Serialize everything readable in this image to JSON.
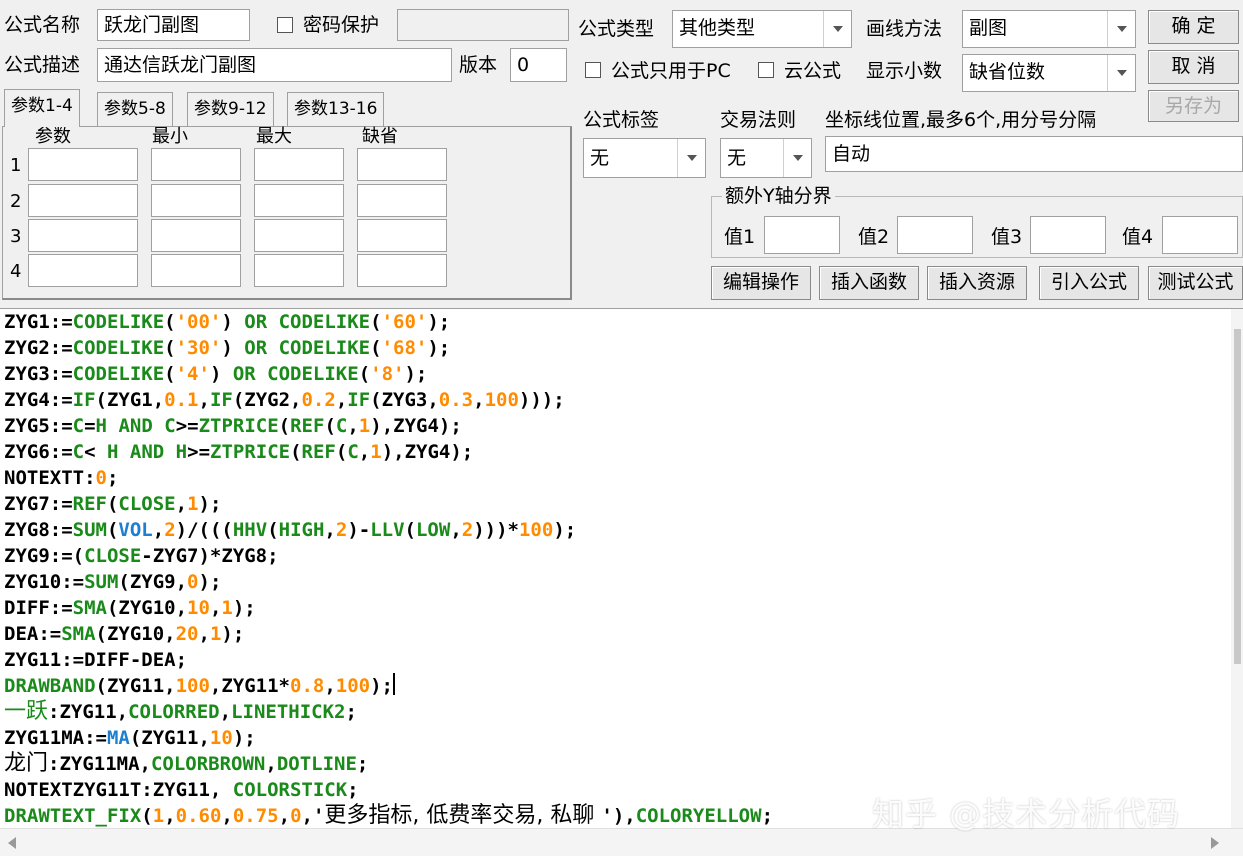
{
  "top": {
    "name_label": "公式名称",
    "name_value": "跃龙门副图",
    "password_label": "密码保护",
    "password_value": "",
    "desc_label": "公式描述",
    "desc_value": "通达信跃龙门副图",
    "version_label": "版本",
    "version_value": "0",
    "type_label": "公式类型",
    "type_value": "其他类型",
    "draw_label": "画线方法",
    "draw_value": "副图",
    "pc_only_label": "公式只用于PC",
    "cloud_label": "云公式",
    "decimal_label": "显示小数",
    "decimal_value": "缺省位数"
  },
  "buttons": {
    "ok": "确 定",
    "cancel": "取 消",
    "save_as": "另存为",
    "edit": "编辑操作",
    "insert_func": "插入函数",
    "insert_res": "插入资源",
    "import": "引入公式",
    "test": "测试公式"
  },
  "tabs": [
    "参数1-4",
    "参数5-8",
    "参数9-12",
    "参数13-16"
  ],
  "params": {
    "headers": [
      "参数",
      "最小",
      "最大",
      "缺省"
    ],
    "rows": [
      "1",
      "2",
      "3",
      "4"
    ]
  },
  "options": {
    "tag_label": "公式标签",
    "tag_value": "无",
    "rule_label": "交易法则",
    "rule_value": "无",
    "axis_label": "坐标线位置,最多6个,用分号分隔",
    "axis_value": "自动",
    "yaxis_group": "额外Y轴分界",
    "v1": "值1",
    "v2": "值2",
    "v3": "值3",
    "v4": "值4"
  },
  "code_lines": [
    "ZYG1:=CODELIKE('00') OR CODELIKE('60');",
    "ZYG2:=CODELIKE('30') OR CODELIKE('68');",
    "ZYG3:=CODELIKE('4') OR CODELIKE('8');",
    "ZYG4:=IF(ZYG1,0.1,IF(ZYG2,0.2,IF(ZYG3,0.3,100)));",
    "ZYG5:=C=H AND C>=ZTPRICE(REF(C,1),ZYG4);",
    "ZYG6:=C< H AND H>=ZTPRICE(REF(C,1),ZYG4);",
    "NOTEXTT:0;",
    "ZYG7:=REF(CLOSE,1);",
    "ZYG8:=SUM(VOL,2)/(((HHV(HIGH,2)-LLV(LOW,2)))*100);",
    "ZYG9:=(CLOSE-ZYG7)*ZYG8;",
    "ZYG10:=SUM(ZYG9,0);",
    "DIFF:=SMA(ZYG10,10,1);",
    "DEA:=SMA(ZYG10,20,1);",
    "ZYG11:=DIFF-DEA;",
    "DRAWBAND(ZYG11,100,ZYG11*0.8,100);",
    "一跃:ZYG11,COLORRED,LINETHICK2;",
    "ZYG11MA:=MA(ZYG11,10);",
    "龙门:ZYG11MA,COLORBROWN,DOTLINE;",
    "NOTEXTZYG11T:ZYG11, COLORSTICK;",
    "DRAWTEXT_FIX(1,0.60,0.75,0,'更多指标, 低费率交易, 私聊 '),COLORYELLOW;"
  ],
  "watermark": "知乎 @技术分析代码"
}
